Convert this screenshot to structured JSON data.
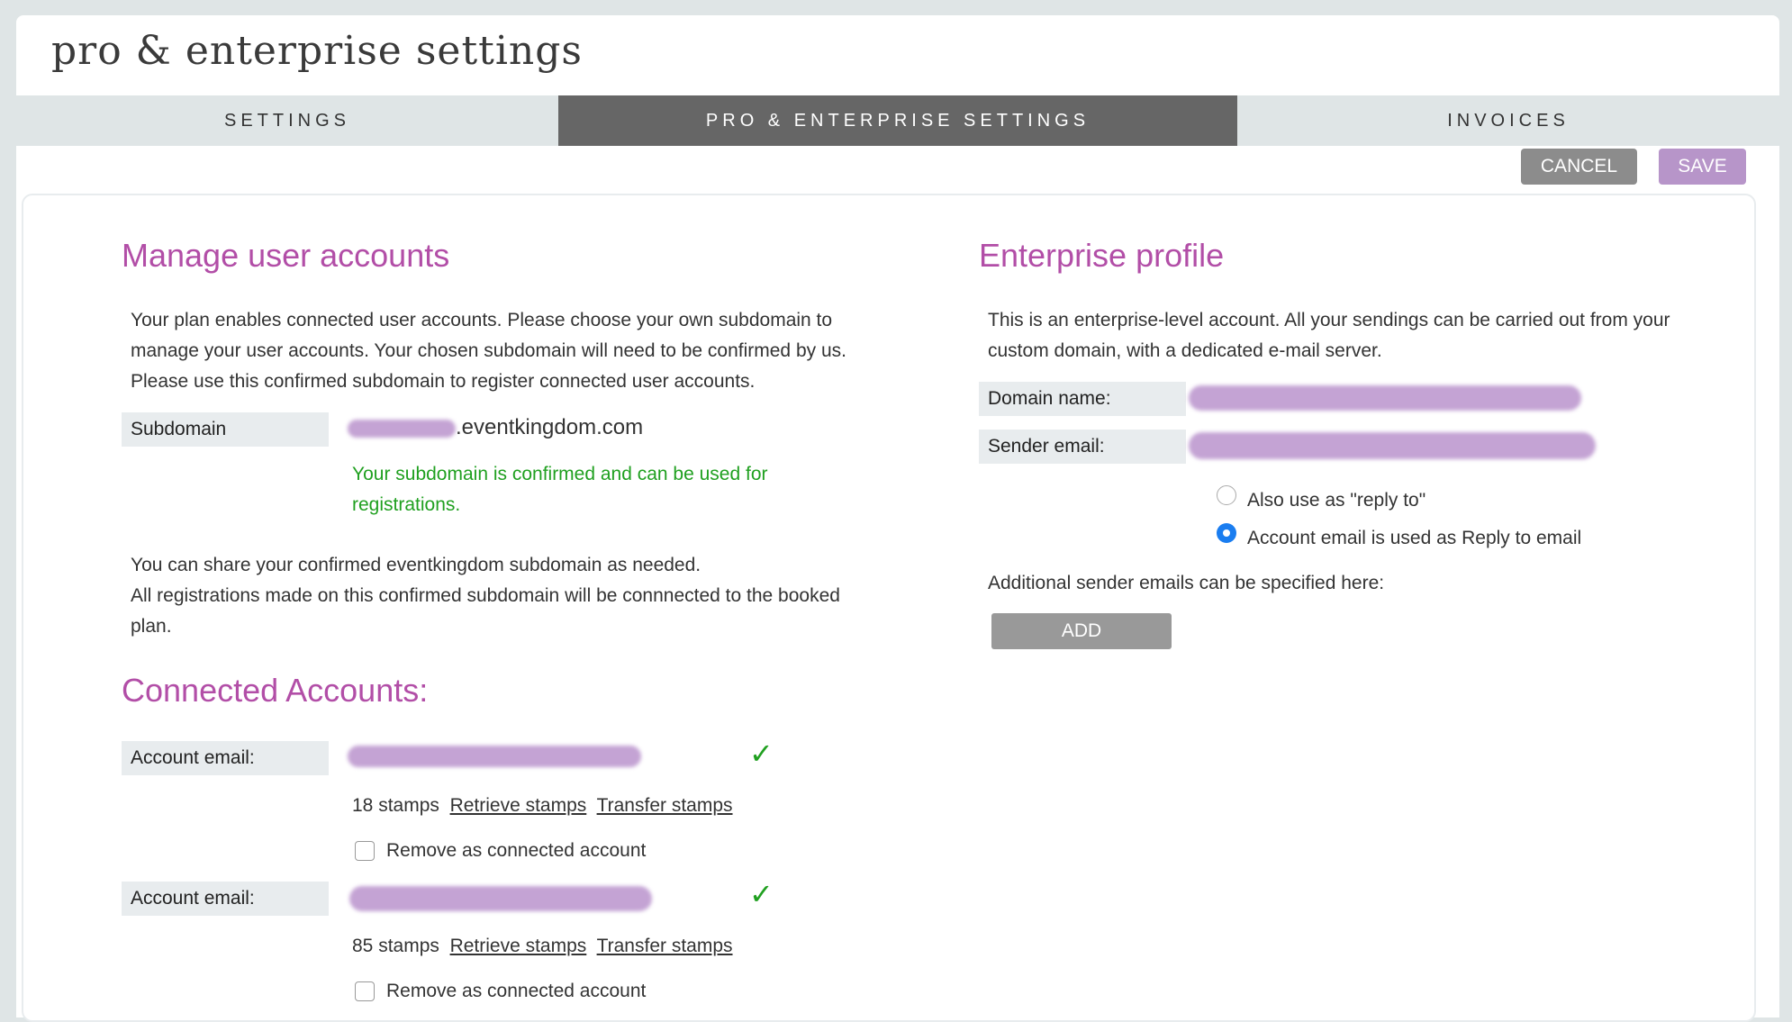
{
  "page_title": "pro & enterprise settings",
  "tabs": [
    {
      "label": "SETTINGS",
      "active": false
    },
    {
      "label": "PRO & ENTERPRISE SETTINGS",
      "active": true
    },
    {
      "label": "INVOICES",
      "active": false
    }
  ],
  "toolbar": {
    "cancel_label": "CANCEL",
    "save_label": "SAVE"
  },
  "manage": {
    "heading": "Manage user accounts",
    "intro_lines": [
      "Your plan enables connected user accounts. Please choose your own subdomain to",
      "manage your user accounts. Your chosen subdomain will need to be confirmed by us.",
      "Please use this confirmed subdomain to register connected user accounts."
    ],
    "subdomain_label": "Subdomain",
    "subdomain_suffix": ".eventkingdom.com",
    "confirmed_lines": [
      "Your subdomain is confirmed and can be used for",
      "registrations."
    ],
    "share_lines": [
      "You can share your confirmed eventkingdom subdomain as needed.",
      "All registrations made on this confirmed subdomain will be connnected to the booked",
      "plan."
    ]
  },
  "connected": {
    "heading": "Connected Accounts:",
    "accounts": [
      {
        "email_label": "Account email:",
        "stamps": "18 stamps",
        "retrieve_label": "Retrieve stamps",
        "transfer_label": "Transfer stamps",
        "remove_label": "Remove as connected account"
      },
      {
        "email_label": "Account email:",
        "stamps": "85 stamps",
        "retrieve_label": "Retrieve stamps",
        "transfer_label": "Transfer stamps",
        "remove_label": "Remove as connected account"
      }
    ]
  },
  "enterprise": {
    "heading": "Enterprise profile",
    "intro_lines": [
      "This is an enterprise-level account. All your sendings can be carried out from your",
      "custom domain, with a dedicated e-mail server."
    ],
    "domain_label": "Domain name:",
    "sender_label": "Sender email:",
    "reply_to_label": "Also use as \"reply to\"",
    "account_reply_label": "Account email is used as Reply to email",
    "additional_text": "Additional sender emails can be specified here:",
    "add_label": "ADD"
  },
  "colors": {
    "accent": "#b24ea7",
    "confirmed": "#20a020",
    "radio_selected": "#1a7df0"
  }
}
